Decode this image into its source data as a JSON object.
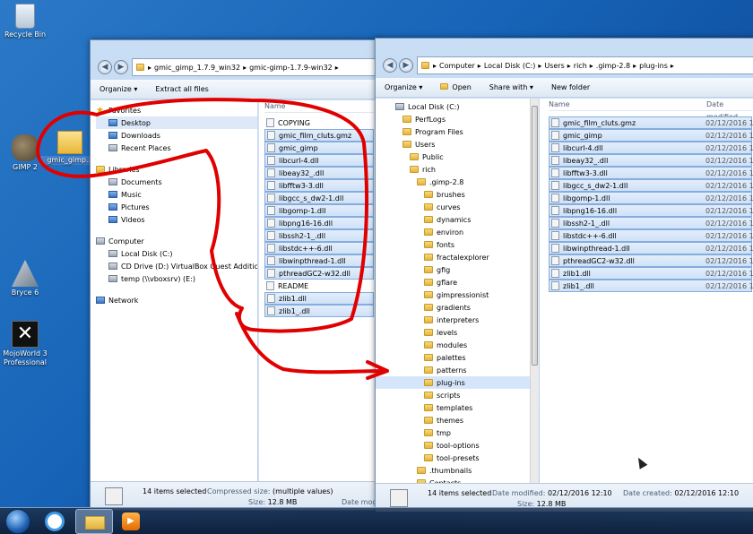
{
  "desktop": {
    "icons": [
      {
        "label": "Recycle Bin"
      },
      {
        "label": "GIMP 2"
      },
      {
        "label": "gmic_gimp..."
      },
      {
        "label": "Bryce 6"
      },
      {
        "label": "MojoWorld 3 Professional"
      }
    ]
  },
  "left_window": {
    "address": [
      "gmic_gimp_1.7.9_win32",
      "gmic-gimp-1.7.9-win32"
    ],
    "toolbar": {
      "organize": "Organize",
      "extract": "Extract all files"
    },
    "nav": {
      "favorites": "Favorites",
      "fav_items": [
        "Desktop",
        "Downloads",
        "Recent Places"
      ],
      "libraries": "Libraries",
      "lib_items": [
        "Documents",
        "Music",
        "Pictures",
        "Videos"
      ],
      "computer": "Computer",
      "comp_items": [
        "Local Disk (C:)",
        "CD Drive (D:) VirtualBox Guest Additions",
        "temp (\\\\vboxsrv) (E:)"
      ],
      "network": "Network"
    },
    "column_name": "Name",
    "files": [
      "COPYING",
      "gmic_film_cluts.gmz",
      "gmic_gimp",
      "libcurl-4.dll",
      "libeay32_.dll",
      "libfftw3-3.dll",
      "libgcc_s_dw2-1.dll",
      "libgomp-1.dll",
      "libpng16-16.dll",
      "libssh2-1_.dll",
      "libstdc++-6.dll",
      "libwinpthread-1.dll",
      "pthreadGC2-w32.dll",
      "README",
      "zlib1.dll",
      "zlib1_.dll"
    ],
    "status": {
      "count": "14 items selected",
      "compressed_label": "Compressed size:",
      "compressed_value": "(multiple values)",
      "size_label": "Size:",
      "size_value": "12.8 MB",
      "date_label": "Date modi"
    }
  },
  "right_window": {
    "address": [
      "Computer",
      "Local Disk (C:)",
      "Users",
      "rich",
      ".gimp-2.8",
      "plug-ins"
    ],
    "toolbar": {
      "organize": "Organize",
      "open": "Open",
      "share": "Share with",
      "new_folder": "New folder"
    },
    "tree": [
      "Local Disk (C:)",
      "PerfLogs",
      "Program Files",
      "Users",
      "Public",
      "rich",
      ".gimp-2.8",
      "brushes",
      "curves",
      "dynamics",
      "environ",
      "fonts",
      "fractalexplorer",
      "gfig",
      "gflare",
      "gimpressionist",
      "gradients",
      "interpreters",
      "levels",
      "modules",
      "palettes",
      "patterns",
      "plug-ins",
      "scripts",
      "templates",
      "themes",
      "tmp",
      "tool-options",
      "tool-presets",
      ".thumbnails",
      "Contacts"
    ],
    "columns": {
      "name": "Name",
      "date": "Date modified"
    },
    "files": [
      "gmic_film_cluts.gmz",
      "gmic_gimp",
      "libcurl-4.dll",
      "libeay32_.dll",
      "libfftw3-3.dll",
      "libgcc_s_dw2-1.dll",
      "libgomp-1.dll",
      "libpng16-16.dll",
      "libssh2-1_.dll",
      "libstdc++-6.dll",
      "libwinpthread-1.dll",
      "pthreadGC2-w32.dll",
      "zlib1.dll",
      "zlib1_.dll"
    ],
    "file_date": "02/12/2016 1",
    "status": {
      "count": "14 items selected",
      "modified_label": "Date modified:",
      "modified_value": "02/12/2016 12:10",
      "created_label": "Date created:",
      "created_value": "02/12/2016 12:10",
      "size_label": "Size:",
      "size_value": "12.8 MB"
    }
  },
  "annotation_color": "#e00000"
}
